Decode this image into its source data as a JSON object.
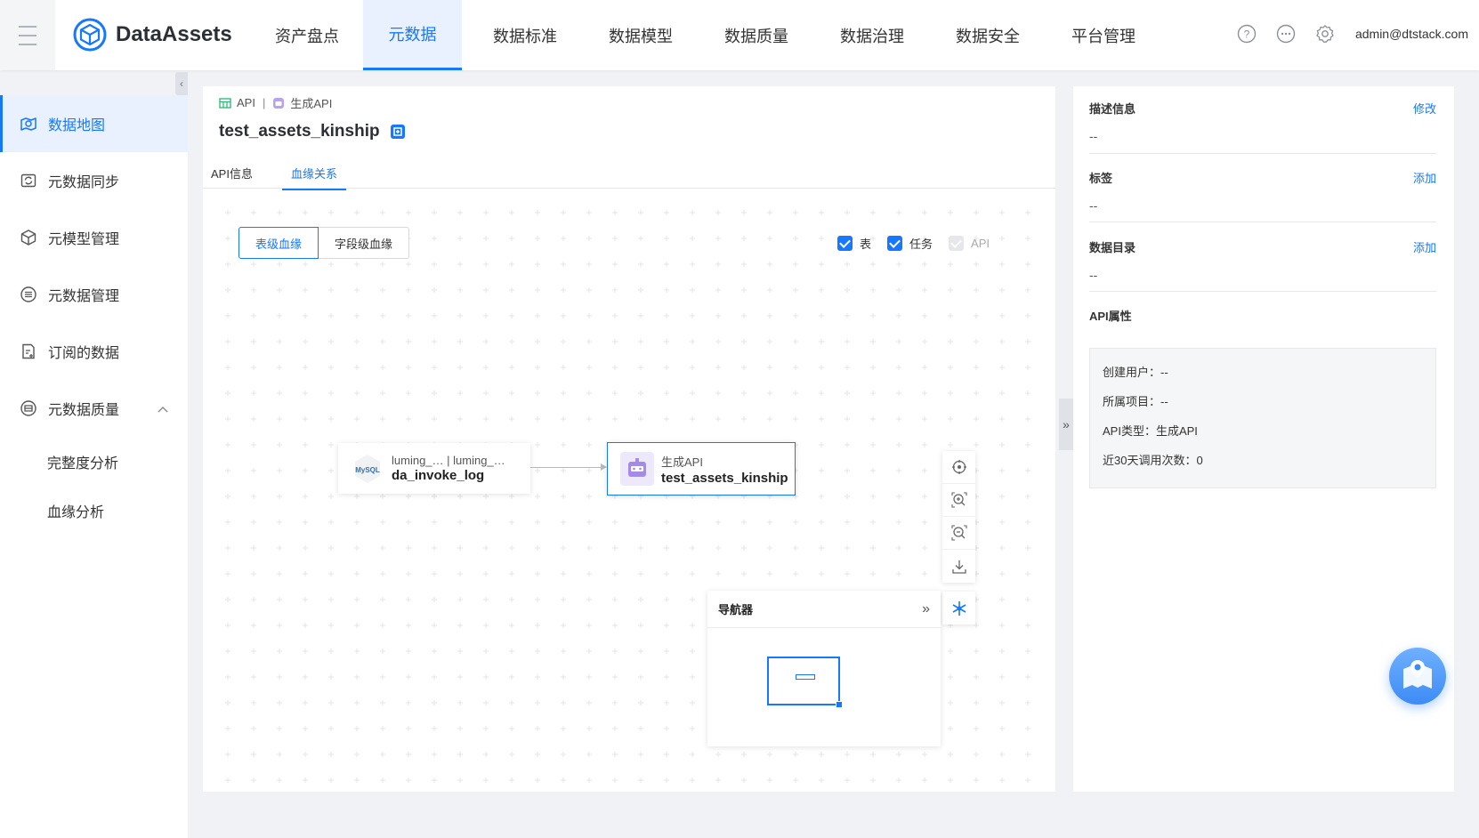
{
  "app": {
    "brand": "DataAssets",
    "user": "admin@dtstack.com",
    "accent": "#1677ff"
  },
  "nav": [
    "资产盘点",
    "元数据",
    "数据标准",
    "数据模型",
    "数据质量",
    "数据治理",
    "数据安全",
    "平台管理"
  ],
  "sidebar": {
    "items": [
      {
        "label": "数据地图",
        "icon": "map-search-icon",
        "active": true
      },
      {
        "label": "元数据同步",
        "icon": "sync-icon"
      },
      {
        "label": "元模型管理",
        "icon": "cube-icon"
      },
      {
        "label": "元数据管理",
        "icon": "database-icon"
      },
      {
        "label": "订阅的数据",
        "icon": "subscribe-icon"
      },
      {
        "label": "元数据质量",
        "icon": "quality-icon",
        "expanded": true
      }
    ],
    "sub_items": [
      "完整度分析",
      "血缘分析"
    ]
  },
  "main": {
    "breadcrumb": {
      "type": "API",
      "sep": "|",
      "subtype": "生成API"
    },
    "title": "test_assets_kinship",
    "tabs": [
      "API信息",
      "血缘关系"
    ],
    "segments": [
      "表级血缘",
      "字段级血缘"
    ],
    "filters": [
      {
        "label": "表",
        "checked": true
      },
      {
        "label": "任务",
        "checked": true
      },
      {
        "label": "API",
        "checked": true,
        "disabled": true
      }
    ],
    "nodes": {
      "source": {
        "line1": "luming_… | luming_…",
        "name": "da_invoke_log",
        "logo": "MySQL"
      },
      "target": {
        "line1": "生成API",
        "name": "test_assets_kinship"
      }
    },
    "navigator": {
      "title": "导航器",
      "collapse": "»"
    }
  },
  "right": {
    "desc": {
      "label": "描述信息",
      "action": "修改",
      "value": "--"
    },
    "tags": {
      "label": "标签",
      "action": "添加",
      "value": "--"
    },
    "catalog": {
      "label": "数据目录",
      "action": "添加",
      "value": "--"
    },
    "props": {
      "label": "API属性",
      "items": [
        "创建用户：--",
        "所属项目：--",
        "API类型：生成API",
        "近30天调用次数：0"
      ]
    },
    "toggle": "»"
  }
}
